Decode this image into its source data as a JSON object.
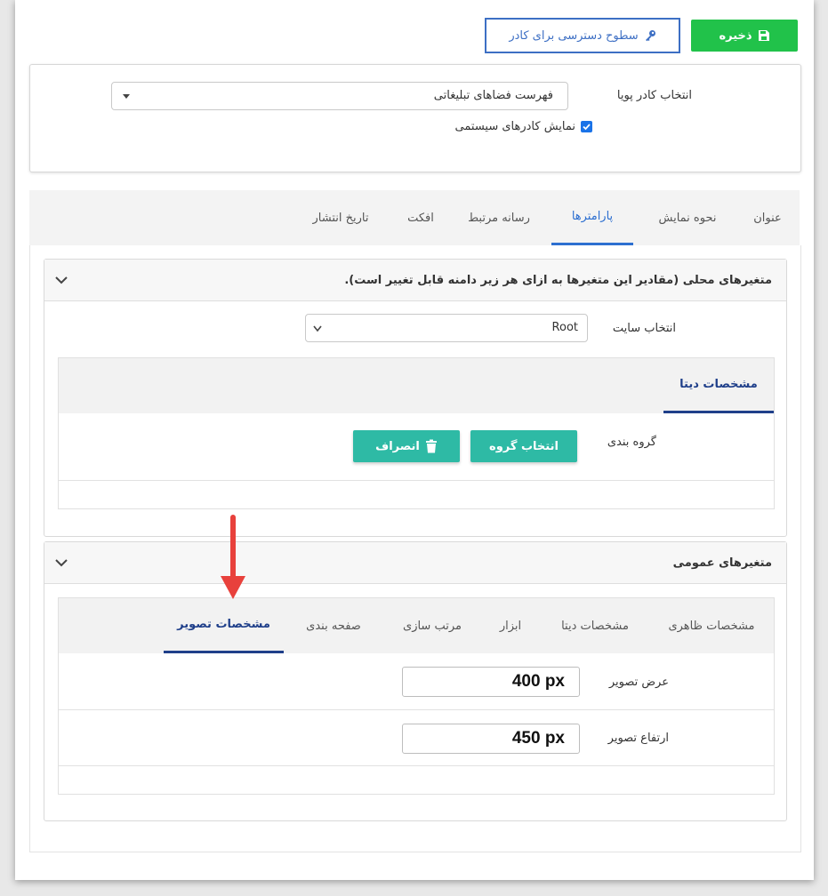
{
  "toolbar": {
    "save_label": "ذخیره",
    "access_label": "سطوح دسترسی برای کادر"
  },
  "frame": {
    "select_label": "انتخاب کادر پویا",
    "selected_value": "فهرست فضاهای تبلیغاتی",
    "show_system_label": "نمایش کادرهای سیستمی",
    "show_system_checked": true
  },
  "tabs": [
    {
      "label": "عنوان"
    },
    {
      "label": "نحوه نمایش"
    },
    {
      "label": "پارامترها",
      "active": true
    },
    {
      "label": "رسانه مرتبط"
    },
    {
      "label": "افکت"
    },
    {
      "label": "تاریخ انتشار"
    }
  ],
  "local_vars": {
    "title": "متغیرهای محلی (مقادیر این متغیرها به ازای هر زیر دامنه قابل تغییر است).",
    "site_label": "انتخاب سایت",
    "site_value": "Root",
    "tab_label": "مشخصات دیتا",
    "grouping_label": "گروه بندی",
    "select_group_label": "انتخاب گروه",
    "cancel_label": "انصراف"
  },
  "global_vars": {
    "title": "متغیرهای عمومی",
    "tabs": [
      {
        "label": "مشخصات ظاهری"
      },
      {
        "label": "مشخصات دیتا"
      },
      {
        "label": "ابزار"
      },
      {
        "label": "مرتب سازی"
      },
      {
        "label": "صفحه بندی"
      },
      {
        "label": "مشخصات تصویر",
        "active": true
      }
    ],
    "width_label": "عرض تصویر",
    "width_value": "400 px",
    "height_label": "ارتفاع تصویر",
    "height_value": "450 px"
  },
  "colors": {
    "save_green": "#21c24a",
    "access_blue": "#3d6fc4",
    "active_tab_blue": "#2d6fd0",
    "teal": "#2ebaa5",
    "annotation_red": "#e8413c"
  }
}
